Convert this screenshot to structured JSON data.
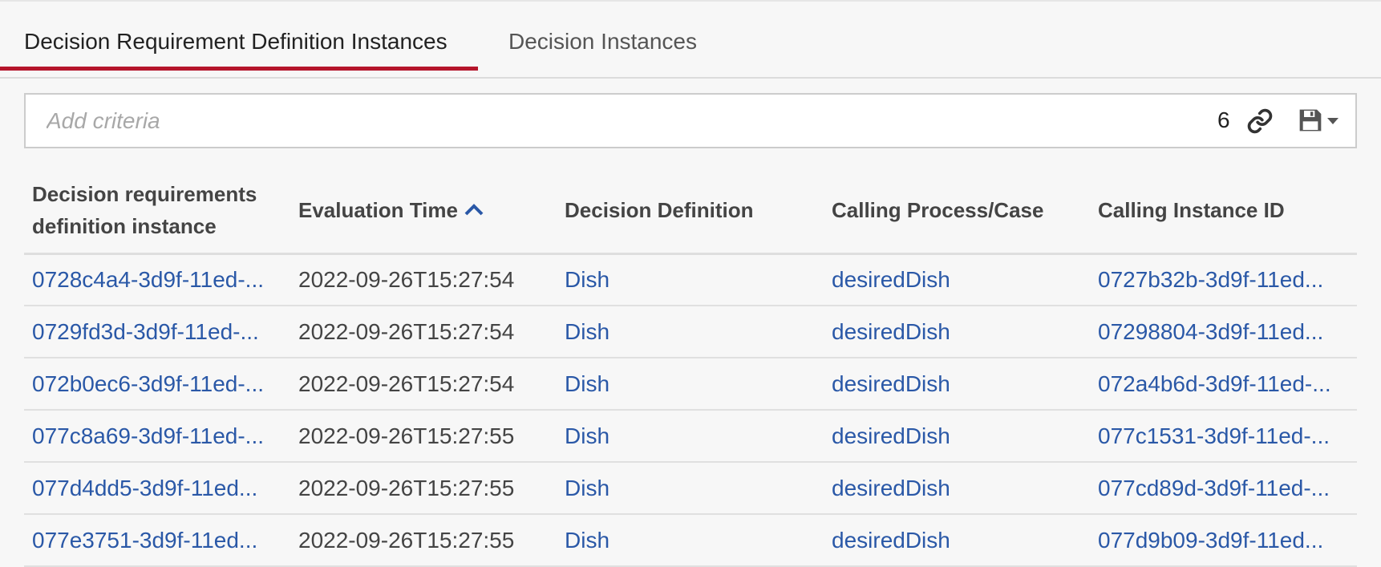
{
  "tabs": [
    {
      "label": "Decision Requirement Definition Instances",
      "active": true
    },
    {
      "label": "Decision Instances",
      "active": false
    }
  ],
  "search": {
    "placeholder": "Add criteria",
    "value": "",
    "result_count": "6"
  },
  "icons": {
    "link": "link-icon",
    "save": "floppy-disk-icon",
    "caret": "caret-down-icon",
    "sort": "chevron-up-icon"
  },
  "colors": {
    "active_tab_underline": "#b5152b",
    "link_text": "#2a58a7",
    "sort_icon": "#2a58a7"
  },
  "table": {
    "headers": [
      "Decision requirements definition instance",
      "Evaluation Time",
      "Decision Definition",
      "Calling Process/Case",
      "Calling Instance ID"
    ],
    "sorted_by": "Evaluation Time",
    "sort_direction": "ascending",
    "rows": [
      [
        "0728c4a4-3d9f-11ed-...",
        "2022-09-26T15:27:54",
        "Dish",
        "desiredDish",
        "0727b32b-3d9f-11ed..."
      ],
      [
        "0729fd3d-3d9f-11ed-...",
        "2022-09-26T15:27:54",
        "Dish",
        "desiredDish",
        "07298804-3d9f-11ed..."
      ],
      [
        "072b0ec6-3d9f-11ed-...",
        "2022-09-26T15:27:54",
        "Dish",
        "desiredDish",
        "072a4b6d-3d9f-11ed-..."
      ],
      [
        "077c8a69-3d9f-11ed-...",
        "2022-09-26T15:27:55",
        "Dish",
        "desiredDish",
        "077c1531-3d9f-11ed-..."
      ],
      [
        "077d4dd5-3d9f-11ed...",
        "2022-09-26T15:27:55",
        "Dish",
        "desiredDish",
        "077cd89d-3d9f-11ed-..."
      ],
      [
        "077e3751-3d9f-11ed...",
        "2022-09-26T15:27:55",
        "Dish",
        "desiredDish",
        "077d9b09-3d9f-11ed..."
      ]
    ]
  }
}
